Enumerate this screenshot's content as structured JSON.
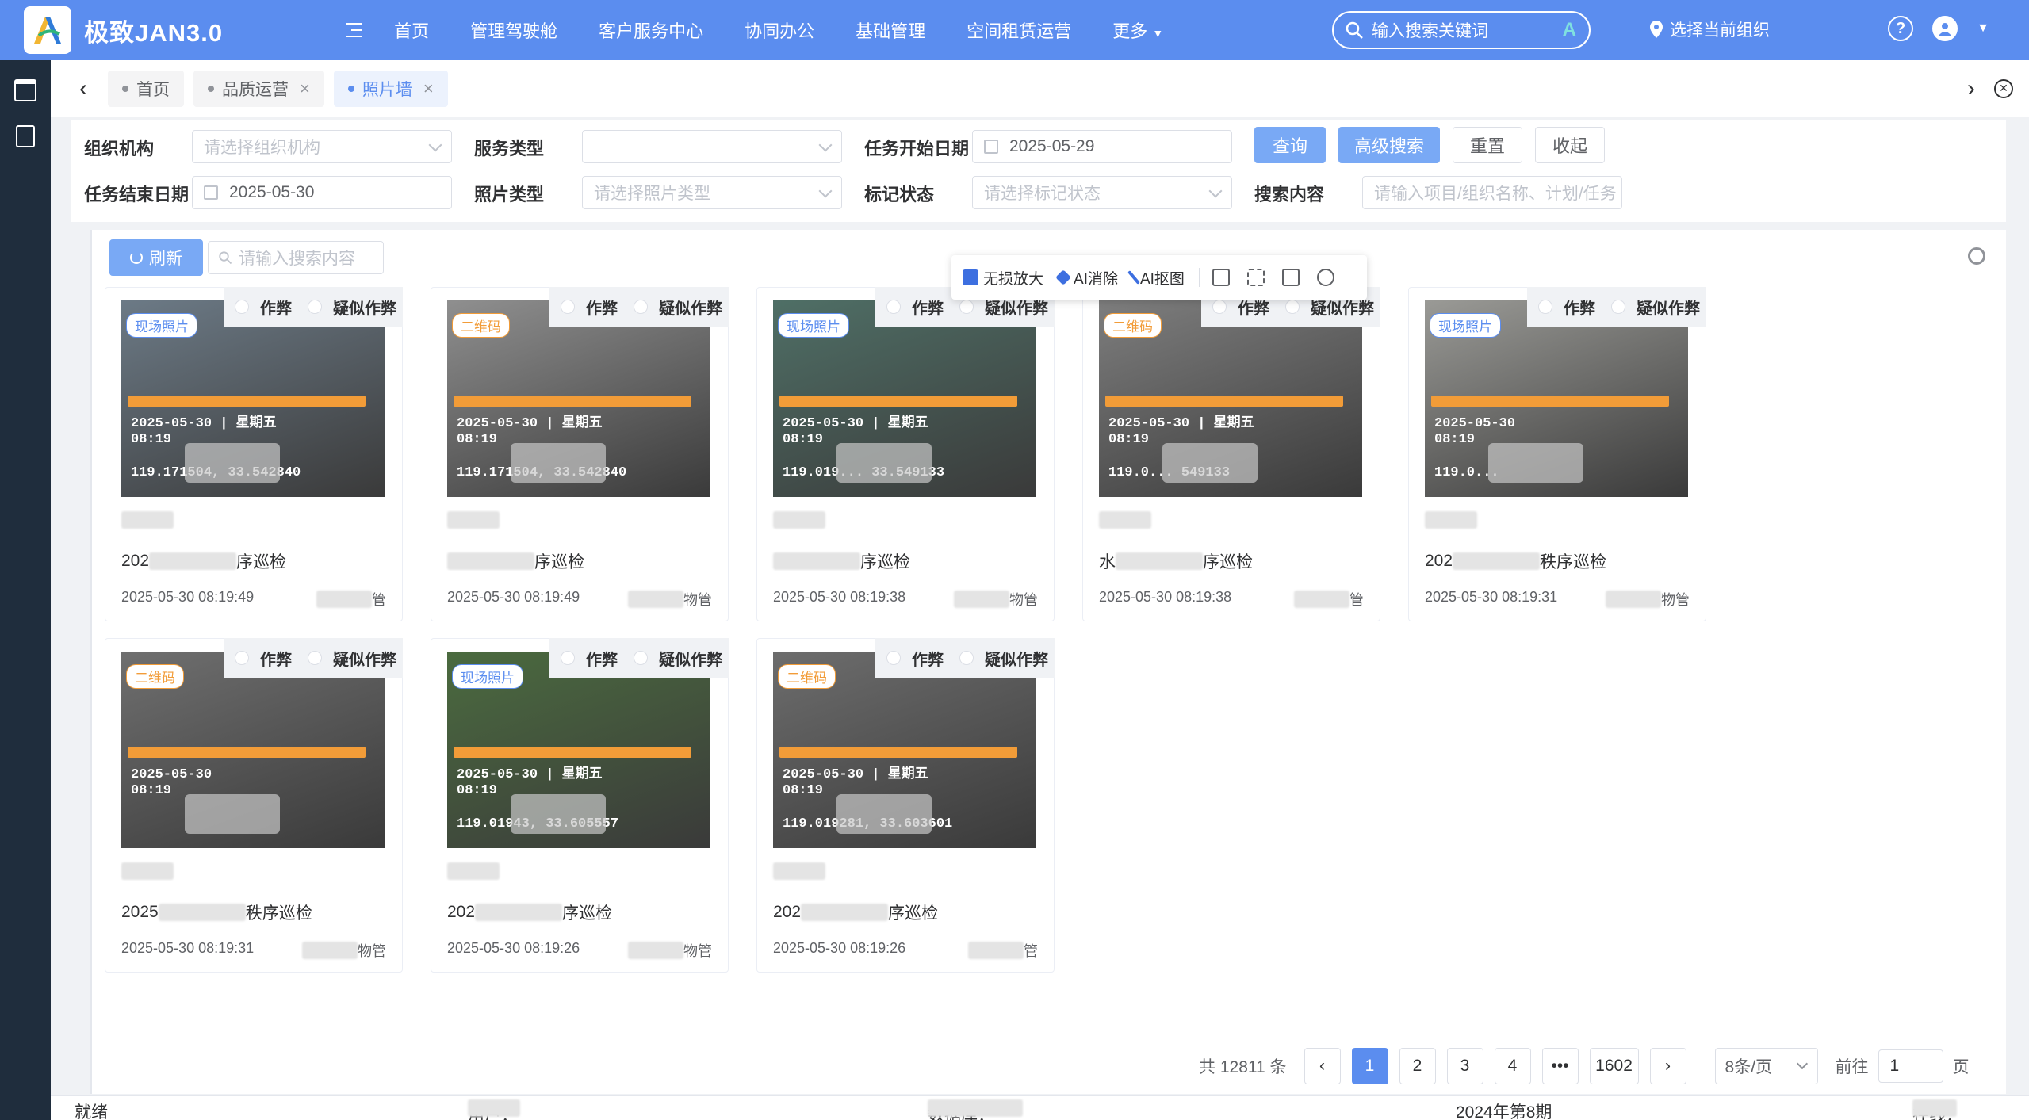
{
  "header": {
    "app_title": "极致JAN3.0",
    "nav": [
      "首页",
      "管理驾驶舱",
      "客户服务中心",
      "协同办公",
      "基础管理",
      "空间租赁运营"
    ],
    "more": "更多",
    "search_placeholder": "输入搜索关键词",
    "search_badge": "A",
    "org_select": "选择当前组织",
    "help": "?"
  },
  "tabs": [
    {
      "label": "首页"
    },
    {
      "label": "品质运营"
    },
    {
      "label": "照片墙"
    }
  ],
  "filters": {
    "org_label": "组织机构",
    "org_placeholder": "请选择组织机构",
    "service_label": "服务类型",
    "start_label": "任务开始日期",
    "start_value": "2025-05-29",
    "end_label": "任务结束日期",
    "end_value": "2025-05-30",
    "photo_type_label": "照片类型",
    "photo_type_placeholder": "请选择照片类型",
    "mark_status_label": "标记状态",
    "mark_status_placeholder": "请选择标记状态",
    "search_label": "搜索内容",
    "search_placeholder": "请输入项目/组织名称、计划/任务",
    "query_btn": "查询",
    "advanced_btn": "高级搜索",
    "reset_btn": "重置",
    "collapse_btn": "收起"
  },
  "toolbar": {
    "refresh": "刷新",
    "search_placeholder": "请输入搜索内容"
  },
  "ai_toolbar": {
    "lossless": "无损放大",
    "erase": "AI消除",
    "cutout": "AI抠图"
  },
  "mark_labels": {
    "cheat": "作弊",
    "suspect": "疑似作弊"
  },
  "cards": [
    {
      "tag": "现场照片",
      "tag_color": "blue",
      "title_prefix": "202",
      "title_suffix": "序巡检",
      "time": "2025-05-30 08:19:49",
      "owner_suffix": "管",
      "stamp_date": "2025-05-30 | 星期五",
      "stamp_time": "08:19",
      "stamp_coord": "119.171504, 33.542840",
      "bg": "#6c7a86"
    },
    {
      "tag": "二维码",
      "tag_color": "orange",
      "title_prefix": "",
      "title_suffix": "序巡检",
      "time": "2025-05-30 08:19:49",
      "owner_suffix": "物管",
      "stamp_date": "2025-05-30 | 星期五",
      "stamp_time": "08:19",
      "stamp_coord": "119.171504, 33.542840",
      "bg": "#8f8f8f"
    },
    {
      "tag": "现场照片",
      "tag_color": "blue",
      "title_prefix": "",
      "title_suffix": "序巡检",
      "time": "2025-05-30 08:19:38",
      "owner_suffix": "物管",
      "stamp_date": "2025-05-30 | 星期五",
      "stamp_time": "08:19",
      "stamp_coord": "119.019... 33.549133",
      "bg": "#4f6f66"
    },
    {
      "tag": "二维码",
      "tag_color": "orange",
      "title_prefix": "水",
      "title_suffix": "序巡检",
      "time": "2025-05-30 08:19:38",
      "owner_suffix": "管",
      "stamp_date": "2025-05-30 | 星期五",
      "stamp_time": "08:19",
      "stamp_coord": "119.0... 549133",
      "bg": "#7e7e7e"
    },
    {
      "tag": "现场照片",
      "tag_color": "blue",
      "title_prefix": "202",
      "title_suffix": "秩序巡检",
      "time": "2025-05-30 08:19:31",
      "owner_suffix": "物管",
      "stamp_date": "2025-05-30",
      "stamp_time": "08:19",
      "stamp_coord": "119.0...",
      "bg": "#9a9a96"
    },
    {
      "tag": "二维码",
      "tag_color": "orange",
      "title_prefix": "2025",
      "title_suffix": "秩序巡检",
      "time": "2025-05-30 08:19:31",
      "owner_suffix": "物管",
      "stamp_date": "2025-05-30",
      "stamp_time": "08:19",
      "stamp_coord": "",
      "bg": "#6f6f6f"
    },
    {
      "tag": "现场照片",
      "tag_color": "blue",
      "title_prefix": "202",
      "title_suffix": "序巡检",
      "time": "2025-05-30 08:19:26",
      "owner_suffix": "物管",
      "stamp_date": "2025-05-30 | 星期五",
      "stamp_time": "08:19",
      "stamp_coord": "119.01943, 33.605557",
      "bg": "#4b6b3f"
    },
    {
      "tag": "二维码",
      "tag_color": "orange",
      "title_prefix": "202",
      "title_suffix": "序巡检",
      "time": "2025-05-30 08:19:26",
      "owner_suffix": "管",
      "stamp_date": "2025-05-30 | 星期五",
      "stamp_time": "08:19",
      "stamp_coord": "119.019281, 33.603601",
      "bg": "#6d6d6d"
    }
  ],
  "pagination": {
    "total": "共 12811 条",
    "pages": [
      "1",
      "2",
      "3",
      "4"
    ],
    "ellipsis": "•••",
    "last": "1602",
    "page_size": "8条/页",
    "goto_prefix": "前往",
    "goto_value": "1",
    "goto_suffix": "页"
  },
  "status": {
    "ready": "就绪",
    "user": "用户：",
    "database": "数据库：",
    "period": "2024年第8期",
    "online": "在线："
  }
}
